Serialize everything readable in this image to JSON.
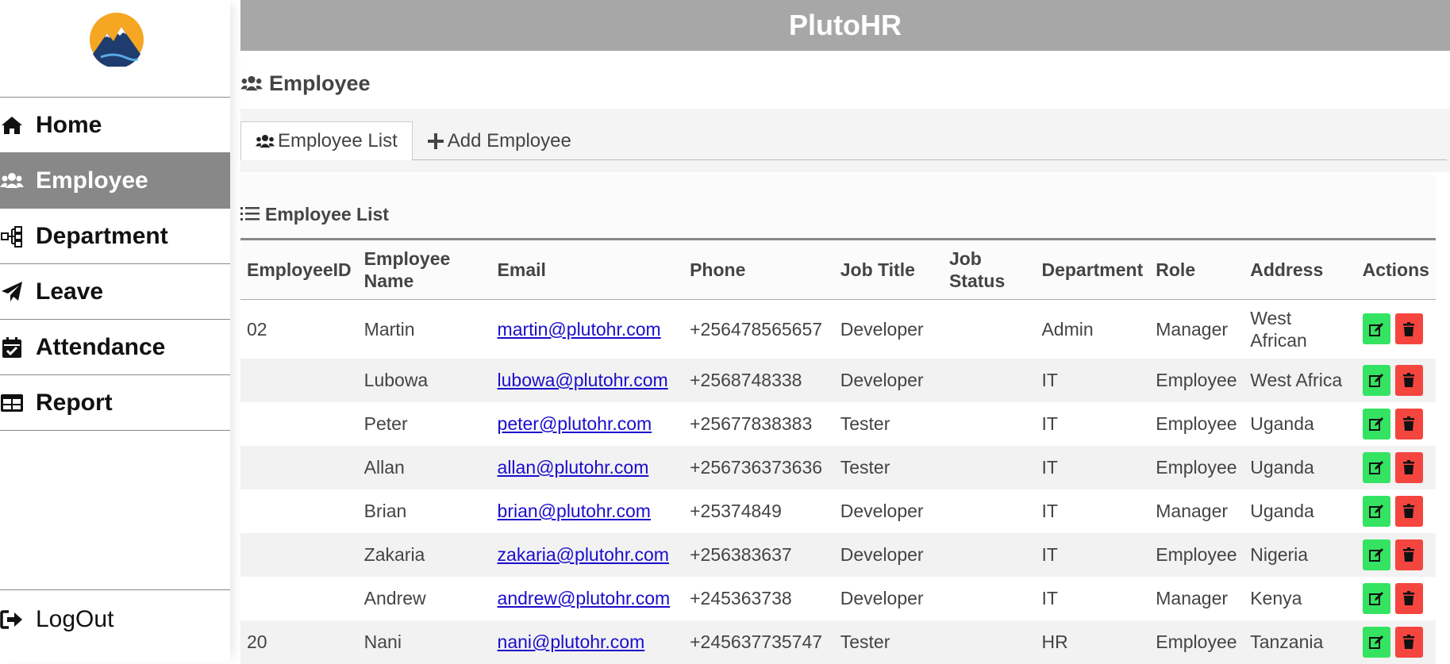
{
  "app": {
    "title": "PlutoHR"
  },
  "sidebar": {
    "items": [
      {
        "label": "Home",
        "icon": "home-icon",
        "active": false
      },
      {
        "label": "Employee",
        "icon": "users-icon",
        "active": true
      },
      {
        "label": "Department",
        "icon": "sitemap-icon",
        "active": false
      },
      {
        "label": "Leave",
        "icon": "paper-plane-icon",
        "active": false
      },
      {
        "label": "Attendance",
        "icon": "calendar-check-icon",
        "active": false
      },
      {
        "label": "Report",
        "icon": "table-icon",
        "active": false
      }
    ],
    "logout_label": "LogOut"
  },
  "page": {
    "heading": "Employee"
  },
  "tabs": [
    {
      "label": "Employee List",
      "active": true
    },
    {
      "label": "Add Employee",
      "active": false
    }
  ],
  "list": {
    "title": "Employee List",
    "columns": [
      "EmployeeID",
      "Employee Name",
      "Email",
      "Phone",
      "Job Title",
      "Job Status",
      "Department",
      "Role",
      "Address",
      "Actions"
    ],
    "rows": [
      {
        "id": "02",
        "name": "Martin",
        "email": "martin@plutohr.com",
        "phone": "+256478565657",
        "job_title": "Developer",
        "job_status": "",
        "department": "Admin",
        "role": "Manager",
        "address": "West African"
      },
      {
        "id": "",
        "name": "Lubowa",
        "email": "lubowa@plutohr.com",
        "phone": "+2568748338",
        "job_title": "Developer",
        "job_status": "",
        "department": "IT",
        "role": "Employee",
        "address": "West Africa"
      },
      {
        "id": "",
        "name": "Peter",
        "email": "peter@plutohr.com",
        "phone": "+25677838383",
        "job_title": "Tester",
        "job_status": "",
        "department": "IT",
        "role": "Employee",
        "address": "Uganda"
      },
      {
        "id": "",
        "name": "Allan",
        "email": "allan@plutohr.com",
        "phone": "+256736373636",
        "job_title": "Tester",
        "job_status": "",
        "department": "IT",
        "role": "Employee",
        "address": "Uganda"
      },
      {
        "id": "",
        "name": "Brian",
        "email": "brian@plutohr.com",
        "phone": "+25374849",
        "job_title": "Developer",
        "job_status": "",
        "department": "IT",
        "role": "Manager",
        "address": "Uganda"
      },
      {
        "id": "",
        "name": "Zakaria",
        "email": "zakaria@plutohr.com",
        "phone": "+256383637",
        "job_title": "Developer",
        "job_status": "",
        "department": "IT",
        "role": "Employee",
        "address": "Nigeria"
      },
      {
        "id": "",
        "name": "Andrew",
        "email": "andrew@plutohr.com",
        "phone": "+245363738",
        "job_title": "Developer",
        "job_status": "",
        "department": "IT",
        "role": "Manager",
        "address": "Kenya"
      },
      {
        "id": "20",
        "name": "Nani",
        "email": "nani@plutohr.com",
        "phone": "+245637735747",
        "job_title": "Tester",
        "job_status": "",
        "department": "HR",
        "role": "Employee",
        "address": "Tanzania"
      }
    ]
  },
  "colors": {
    "header": "#a8a7a8",
    "active_nav": "#888888",
    "edit": "#34e361",
    "delete": "#f5453f",
    "link": "#1a0dcc"
  }
}
